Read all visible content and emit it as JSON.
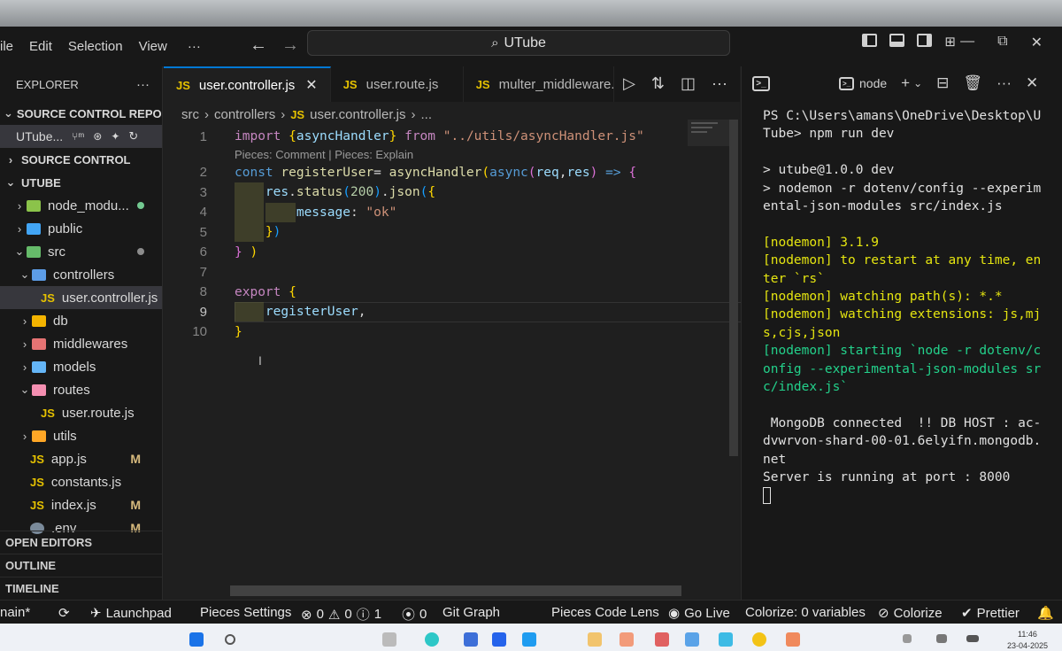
{
  "titlebar": {
    "menu": [
      "ile",
      "Edit",
      "Selection",
      "View",
      "···"
    ],
    "search_text": "UTube",
    "caption": {
      "minimize": "—",
      "maximize": "⧉",
      "close": "✕"
    }
  },
  "sidebar": {
    "header": "EXPLORER",
    "more": "···",
    "section_repos": "SOURCE CONTROL REPOSI...",
    "repo_name": "UTube...",
    "section_sc": "SOURCE CONTROL",
    "section_project": "UTUBE",
    "tree": [
      {
        "label": "node_modu...",
        "type": "folder",
        "depth": 1,
        "open": false,
        "badge": "dot-green"
      },
      {
        "label": "public",
        "type": "folder",
        "depth": 1,
        "open": false
      },
      {
        "label": "src",
        "type": "folder",
        "depth": 1,
        "open": true,
        "badge": "dot-gray"
      },
      {
        "label": "controllers",
        "type": "folder",
        "depth": 2,
        "open": true
      },
      {
        "label": "user.controller.js",
        "type": "js",
        "depth": 3,
        "selected": true
      },
      {
        "label": "db",
        "type": "folder",
        "depth": 2,
        "open": false
      },
      {
        "label": "middlewares",
        "type": "folder",
        "depth": 2,
        "open": false
      },
      {
        "label": "models",
        "type": "folder",
        "depth": 2,
        "open": false
      },
      {
        "label": "routes",
        "type": "folder",
        "depth": 2,
        "open": true
      },
      {
        "label": "user.route.js",
        "type": "js",
        "depth": 3
      },
      {
        "label": "utils",
        "type": "folder",
        "depth": 2,
        "open": false
      },
      {
        "label": "app.js",
        "type": "js",
        "depth": 2,
        "badge": "M"
      },
      {
        "label": "constants.js",
        "type": "js",
        "depth": 2
      },
      {
        "label": "index.js",
        "type": "js",
        "depth": 2,
        "badge": "M"
      },
      {
        "label": ".env",
        "type": "env",
        "depth": 2,
        "badge": "M"
      }
    ],
    "bottom": [
      "OPEN EDITORS",
      "OUTLINE",
      "TIMELINE"
    ]
  },
  "editor": {
    "tabs": [
      {
        "label": "user.controller.js",
        "active": true
      },
      {
        "label": "user.route.js",
        "active": false
      },
      {
        "label": "multer_middleware.js",
        "active": false
      }
    ],
    "breadcrumb": [
      "src",
      "controllers",
      "user.controller.js",
      "..."
    ],
    "code_lens": "Pieces: Comment | Pieces: Explain",
    "line_numbers": [
      "1",
      "2",
      "3",
      "4",
      "5",
      "6",
      "7",
      "8",
      "9",
      "10"
    ]
  },
  "terminal": {
    "shell": "node",
    "lines": [
      {
        "t": "PS C:\\Users\\amans\\OneDrive\\Desktop\\UTube> npm run dev",
        "c": ""
      },
      {
        "t": "",
        "c": ""
      },
      {
        "t": "> utube@1.0.0 dev",
        "c": ""
      },
      {
        "t": "> nodemon -r dotenv/config --experimental-json-modules src/index.js",
        "c": ""
      },
      {
        "t": "",
        "c": ""
      },
      {
        "t": "[nodemon] 3.1.9",
        "c": "y"
      },
      {
        "t": "[nodemon] to restart at any time, enter `rs`",
        "c": "y"
      },
      {
        "t": "[nodemon] watching path(s): *.*",
        "c": "y"
      },
      {
        "t": "[nodemon] watching extensions: js,mjs,cjs,json",
        "c": "y"
      },
      {
        "t": "[nodemon] starting `node -r dotenv/config --experimental-json-modules src/index.js`",
        "c": "g"
      },
      {
        "t": "",
        "c": ""
      },
      {
        "t": " MongoDB connected  !! DB HOST : ac-dvwrvon-shard-00-01.6elyifn.mongodb.net",
        "c": ""
      },
      {
        "t": "Server is running at port : 8000",
        "c": ""
      }
    ]
  },
  "statusbar": {
    "branch": "nain*",
    "launchpad": "Launchpad",
    "pieces_settings": "Pieces Settings",
    "errors": "0",
    "warnings": "0",
    "info": "1",
    "ports": "0",
    "git_graph": "Git Graph",
    "pieces_lens": "Pieces Code Lens",
    "go_live": "Go Live",
    "colorize_vars": "Colorize: 0 variables",
    "colorize": "Colorize",
    "prettier": "Prettier"
  },
  "taskbar": {
    "time": "11:46",
    "date": "23-04-2025"
  }
}
